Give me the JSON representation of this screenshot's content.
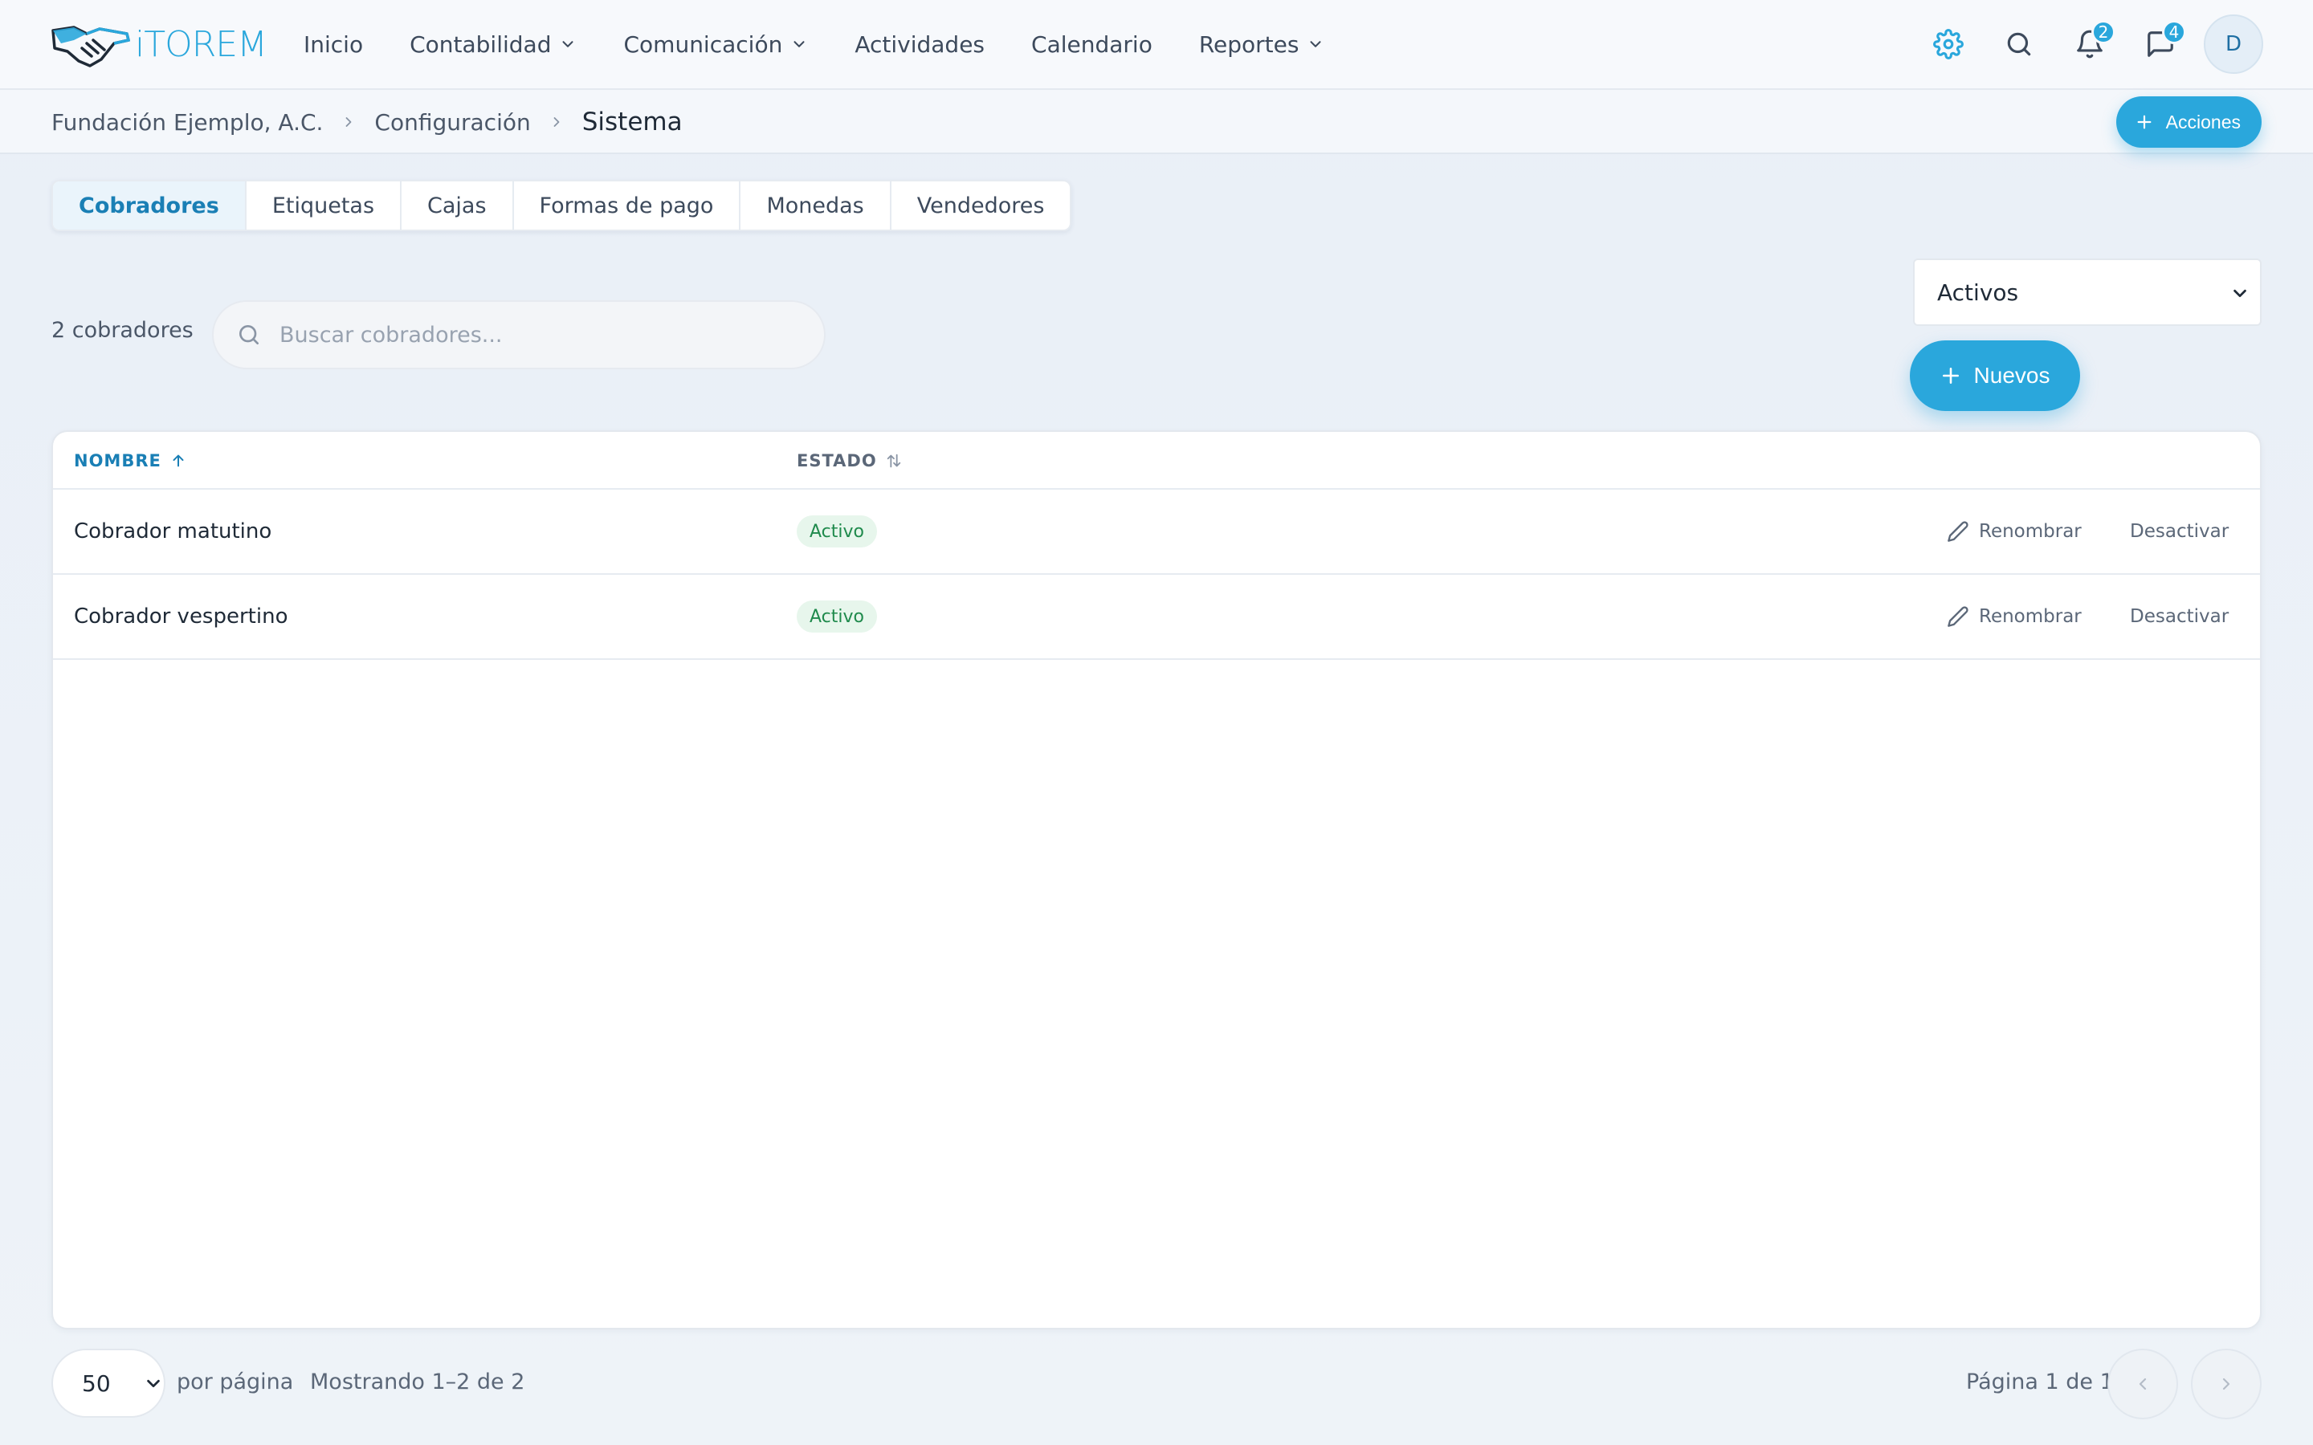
{
  "brand": {
    "name": "iTOREM",
    "accent": "#2aa7dc"
  },
  "nav": {
    "items": [
      {
        "label": "Inicio",
        "dropdown": false
      },
      {
        "label": "Contabilidad",
        "dropdown": true
      },
      {
        "label": "Comunicación",
        "dropdown": true
      },
      {
        "label": "Actividades",
        "dropdown": false
      },
      {
        "label": "Calendario",
        "dropdown": false
      },
      {
        "label": "Reportes",
        "dropdown": true
      }
    ],
    "notifications_count": "2",
    "messages_count": "4",
    "avatar_initial": "D"
  },
  "breadcrumb": {
    "items": [
      "Fundación Ejemplo, A.C.",
      "Configuración"
    ],
    "current": "Sistema"
  },
  "actions_button": {
    "label": "Acciones"
  },
  "tabs": [
    {
      "label": "Cobradores",
      "active": true
    },
    {
      "label": "Etiquetas",
      "active": false
    },
    {
      "label": "Cajas",
      "active": false
    },
    {
      "label": "Formas de pago",
      "active": false
    },
    {
      "label": "Monedas",
      "active": false
    },
    {
      "label": "Vendedores",
      "active": false
    }
  ],
  "toolbar": {
    "count_label": "2 cobradores",
    "search_placeholder": "Buscar cobradores...",
    "search_value": "",
    "status_filter": "Activos",
    "new_button": "Nuevos"
  },
  "table": {
    "columns": {
      "name": "NOMBRE",
      "status": "ESTADO"
    },
    "sort": {
      "column": "name",
      "direction": "asc"
    },
    "rows": [
      {
        "name": "Cobrador matutino",
        "status": "Activo",
        "rename": "Renombrar",
        "deactivate": "Desactivar"
      },
      {
        "name": "Cobrador vespertino",
        "status": "Activo",
        "rename": "Renombrar",
        "deactivate": "Desactivar"
      }
    ]
  },
  "pagination": {
    "per_page": "50",
    "per_page_label": "por página",
    "showing": "Mostrando 1–2 de 2",
    "page_info": "Página 1 de 1"
  },
  "icons": {
    "settings": "gear-icon",
    "search": "search-icon",
    "notifications": "bell-icon",
    "messages": "chat-icon"
  }
}
